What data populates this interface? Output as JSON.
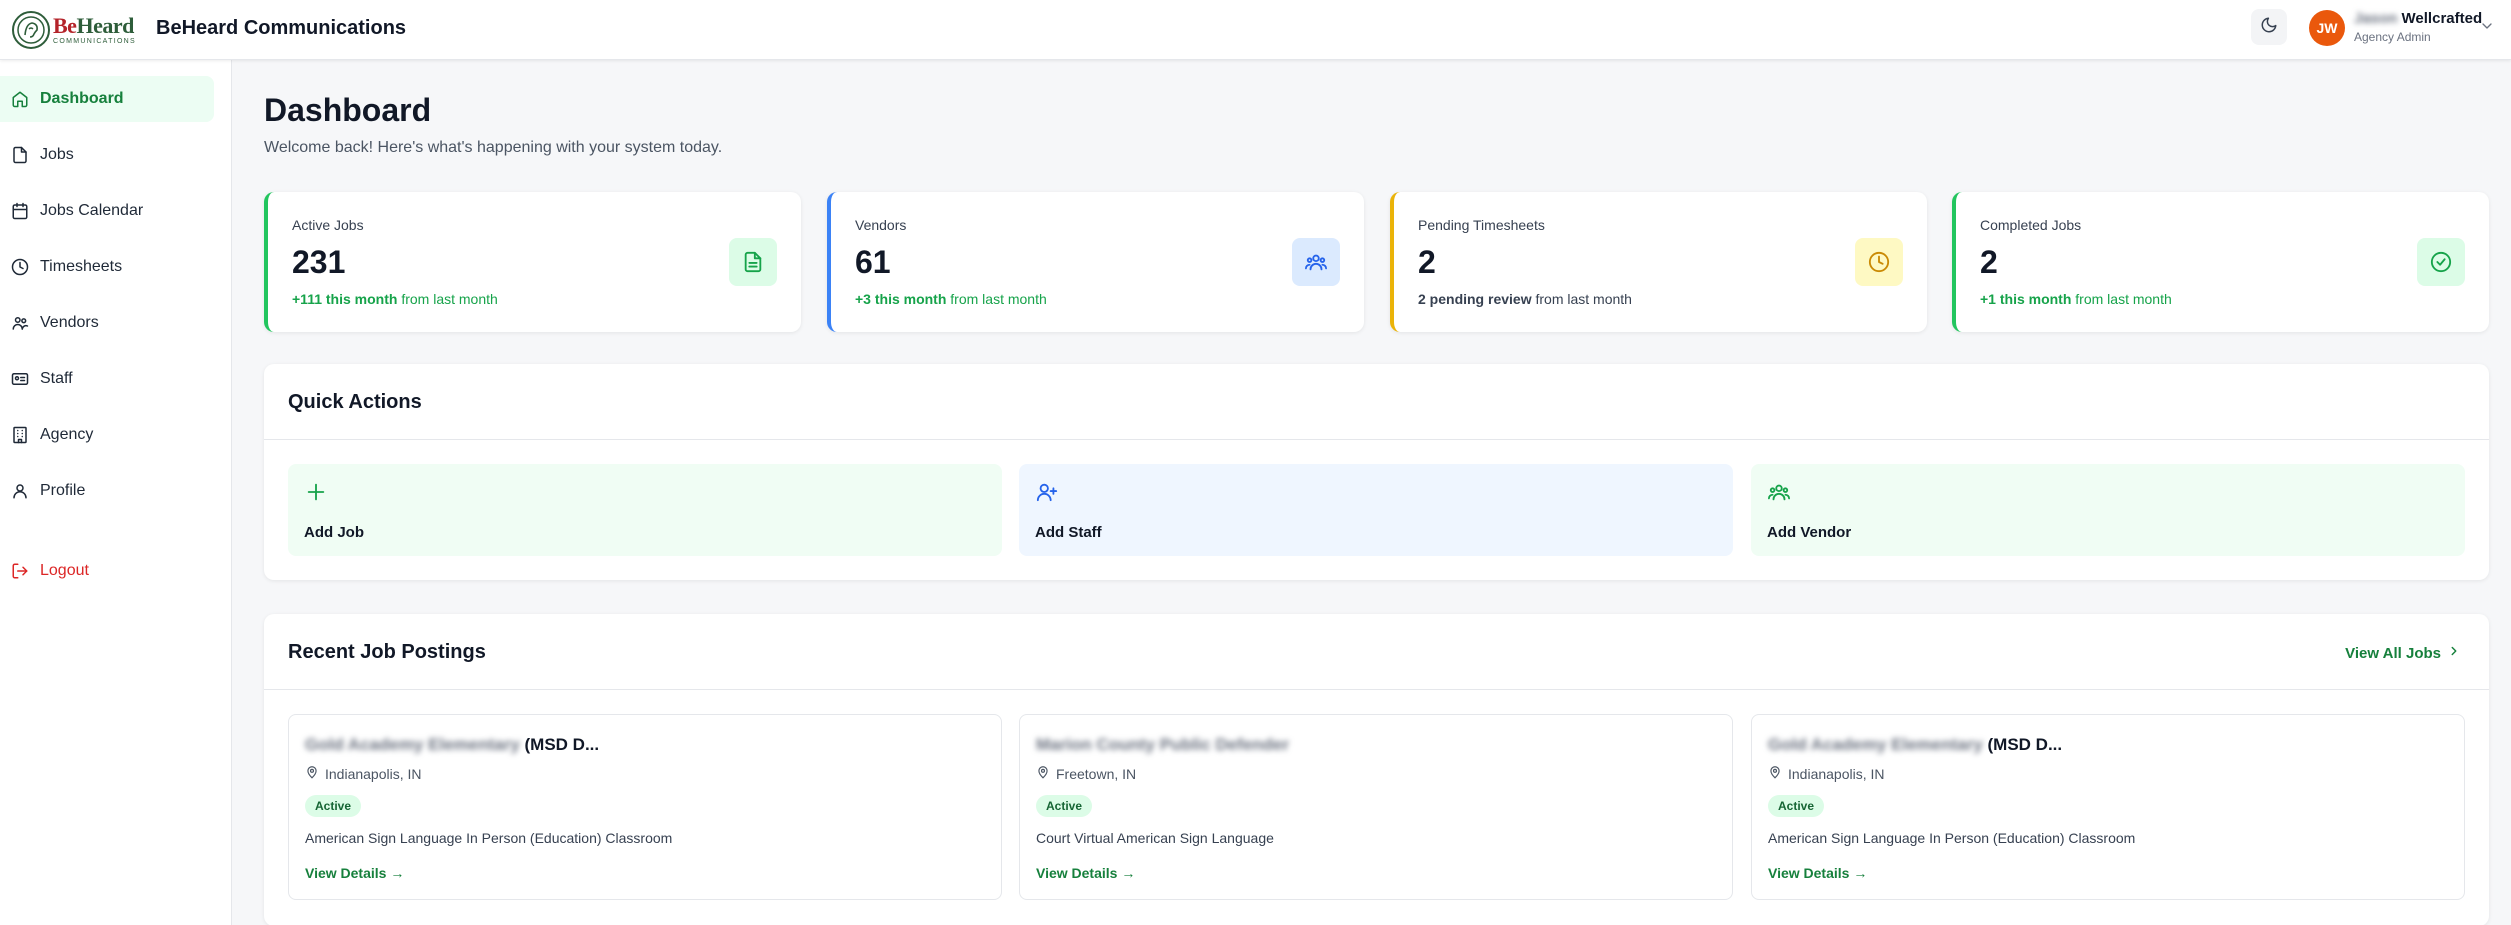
{
  "header": {
    "brand_logo_text": "BeHeard",
    "brand_logo_subtext": "COMMUNICATIONS",
    "app_title": "BeHeard Communications",
    "theme_toggle_icon": "moon-icon",
    "user": {
      "initials": "JW",
      "name_hidden": "Jason",
      "name": "Wellcrafted",
      "role": "Agency Admin",
      "avatar_color": "#ea580c"
    }
  },
  "sidebar": {
    "items": [
      {
        "label": "Dashboard",
        "icon": "home-icon",
        "active": true
      },
      {
        "label": "Jobs",
        "icon": "file-icon"
      },
      {
        "label": "Jobs Calendar",
        "icon": "calendar-icon"
      },
      {
        "label": "Timesheets",
        "icon": "clock-icon"
      },
      {
        "label": "Vendors",
        "icon": "users-icon"
      },
      {
        "label": "Staff",
        "icon": "id-card-icon"
      },
      {
        "label": "Agency",
        "icon": "building-icon"
      },
      {
        "label": "Profile",
        "icon": "user-icon"
      }
    ],
    "logout": {
      "label": "Logout",
      "icon": "logout-icon"
    }
  },
  "main": {
    "title": "Dashboard",
    "subtitle": "Welcome back! Here's what's happening with your system today.",
    "stats": [
      {
        "label": "Active Jobs",
        "value": "231",
        "change_bold": "+111 this month",
        "change_rest": " from last month",
        "accent": "#22c55e",
        "icon": "document-icon",
        "icon_bg": "#dcfce7",
        "icon_color": "#16a34a"
      },
      {
        "label": "Vendors",
        "value": "61",
        "change_bold": "+3 this month",
        "change_rest": " from last month",
        "accent": "#3b82f6",
        "icon": "users-icon",
        "icon_bg": "#dbeafe",
        "icon_color": "#2563eb"
      },
      {
        "label": "Pending Timesheets",
        "value": "2",
        "change_bold": "2 pending review",
        "change_rest": " from last month",
        "accent": "#eab308",
        "icon": "clock-icon",
        "icon_bg": "#fef9c3",
        "icon_color": "#ca8a04"
      },
      {
        "label": "Completed Jobs",
        "value": "2",
        "change_bold": "+1 this month",
        "change_rest": " from last month",
        "accent": "#22c55e",
        "icon": "check-circle-icon",
        "icon_bg": "#dcfce7",
        "icon_color": "#16a34a"
      }
    ],
    "quick_actions": {
      "title": "Quick Actions",
      "items": [
        {
          "label": "Add Job",
          "icon": "plus-icon",
          "bg": "#f0fdf4",
          "icon_color": "#16a34a"
        },
        {
          "label": "Add Staff",
          "icon": "user-plus-icon",
          "bg": "#eff6ff",
          "icon_color": "#2563eb"
        },
        {
          "label": "Add Vendor",
          "icon": "users-icon",
          "bg": "#f0fdf4",
          "icon_color": "#16a34a"
        }
      ]
    },
    "recent_jobs": {
      "title": "Recent Job Postings",
      "view_all": "View All Jobs",
      "jobs": [
        {
          "title_hidden": "Gold Academy Elementary",
          "title_suffix": " (MSD D...",
          "location": "Indianapolis, IN",
          "status": "Active",
          "description": "American Sign Language In Person (Education) Classroom",
          "link": "View Details →"
        },
        {
          "title_hidden": "Marion County Public Defender",
          "title_suffix": "",
          "location": "Freetown, IN",
          "status": "Active",
          "description": "Court Virtual American Sign Language",
          "link": "View Details →"
        },
        {
          "title_hidden": "Gold Academy Elementary",
          "title_suffix": " (MSD D...",
          "location": "Indianapolis, IN",
          "status": "Active",
          "description": "American Sign Language In Person (Education) Classroom",
          "link": "View Details →"
        }
      ]
    }
  }
}
